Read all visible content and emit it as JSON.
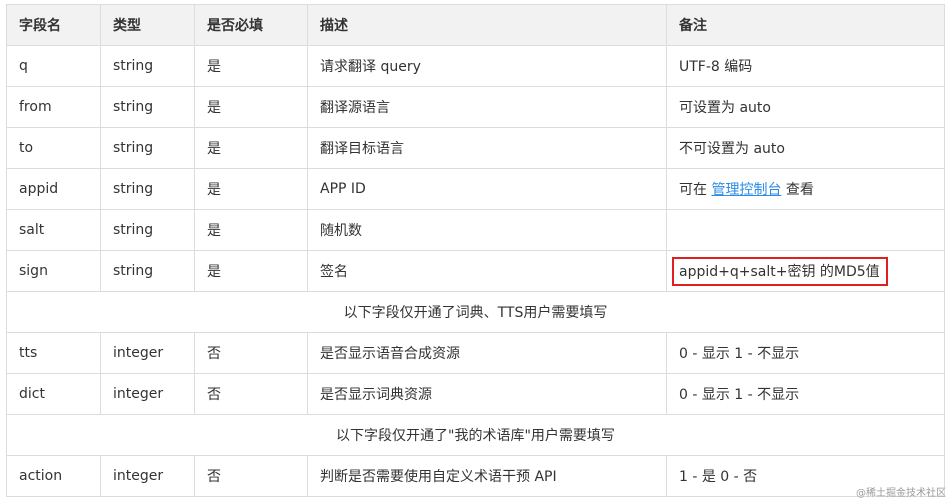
{
  "headers": [
    "字段名",
    "类型",
    "是否必填",
    "描述",
    "备注"
  ],
  "rows": [
    {
      "field": "q",
      "type": "string",
      "required": "是",
      "desc": "请求翻译 query",
      "note": "UTF-8 编码"
    },
    {
      "field": "from",
      "type": "string",
      "required": "是",
      "desc": "翻译源语言",
      "note": "可设置为 auto"
    },
    {
      "field": "to",
      "type": "string",
      "required": "是",
      "desc": "翻译目标语言",
      "note": "不可设置为 auto"
    },
    {
      "field": "appid",
      "type": "string",
      "required": "是",
      "desc": "APP ID",
      "note_prefix": "可在",
      "note_link": "管理控制台",
      "note_suffix": "查看"
    },
    {
      "field": "salt",
      "type": "string",
      "required": "是",
      "desc": "随机数",
      "note": ""
    },
    {
      "field": "sign",
      "type": "string",
      "required": "是",
      "desc": "签名",
      "note": "appid+q+salt+密钥 的MD5值"
    }
  ],
  "section1_note": "以下字段仅开通了词典、TTS用户需要填写",
  "rows2": [
    {
      "field": "tts",
      "type": "integer",
      "required": "否",
      "desc": "是否显示语音合成资源",
      "note": "0 - 显示 1 - 不显示"
    },
    {
      "field": "dict",
      "type": "integer",
      "required": "否",
      "desc": "是否显示词典资源",
      "note": "0 - 显示 1 - 不显示"
    }
  ],
  "section2_note": "以下字段仅开通了\"我的术语库\"用户需要填写",
  "rows3": [
    {
      "field": "action",
      "type": "integer",
      "required": "否",
      "desc": "判断是否需要使用自定义术语干预 API",
      "note": "1 - 是 0 - 否"
    }
  ],
  "watermark": "@稀土掘金技术社区",
  "colors": {
    "header_bg": "#f2f2f2",
    "border": "#dcdcdc",
    "link": "#2b8be8",
    "highlight_border": "#e02020"
  }
}
